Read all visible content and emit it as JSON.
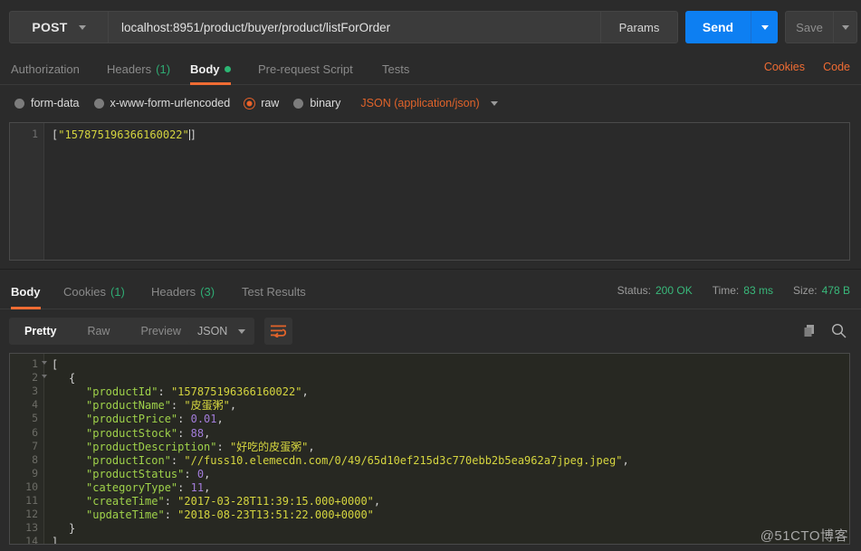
{
  "request": {
    "method": "POST",
    "url": "localhost:8951/product/buyer/product/listForOrder",
    "params_label": "Params",
    "send_label": "Send",
    "save_label": "Save",
    "tabs": [
      {
        "label": "Authorization",
        "active": false
      },
      {
        "label": "Headers",
        "count": "(1)",
        "active": false
      },
      {
        "label": "Body",
        "active": true,
        "dot": true
      },
      {
        "label": "Pre-request Script",
        "active": false
      },
      {
        "label": "Tests",
        "active": false
      }
    ],
    "cookies_link": "Cookies",
    "code_link": "Code",
    "body_types": [
      {
        "label": "form-data",
        "selected": false
      },
      {
        "label": "x-www-form-urlencoded",
        "selected": false
      },
      {
        "label": "raw",
        "selected": true
      },
      {
        "label": "binary",
        "selected": false
      }
    ],
    "content_type": "JSON (application/json)",
    "body_line_number": "1",
    "body_bracket_open": "[",
    "body_quote_open": "\"",
    "body_value": "157875196366160022",
    "body_quote_close": "\"",
    "body_bracket_close": "]"
  },
  "response": {
    "tabs": [
      {
        "label": "Body",
        "active": true
      },
      {
        "label": "Cookies",
        "count": "(1)",
        "active": false
      },
      {
        "label": "Headers",
        "count": "(3)",
        "active": false
      },
      {
        "label": "Test Results",
        "active": false
      }
    ],
    "status_label": "Status:",
    "status_value": "200 OK",
    "time_label": "Time:",
    "time_value": "83 ms",
    "size_label": "Size:",
    "size_value": "478 B",
    "view_modes": [
      {
        "label": "Pretty",
        "active": true
      },
      {
        "label": "Raw",
        "active": false
      },
      {
        "label": "Preview",
        "active": false
      }
    ],
    "format": "JSON",
    "lines": [
      {
        "n": "1",
        "fold": true,
        "indent": 0,
        "parts": [
          {
            "t": "[",
            "c": "pln"
          }
        ]
      },
      {
        "n": "2",
        "fold": true,
        "indent": 1,
        "parts": [
          {
            "t": "{",
            "c": "pln"
          }
        ]
      },
      {
        "n": "3",
        "fold": false,
        "indent": 2,
        "parts": [
          {
            "t": "\"productId\"",
            "c": "key"
          },
          {
            "t": ": ",
            "c": "pln"
          },
          {
            "t": "\"157875196366160022\"",
            "c": "str"
          },
          {
            "t": ",",
            "c": "pln"
          }
        ]
      },
      {
        "n": "4",
        "fold": false,
        "indent": 2,
        "parts": [
          {
            "t": "\"productName\"",
            "c": "key"
          },
          {
            "t": ": ",
            "c": "pln"
          },
          {
            "t": "\"皮蛋粥\"",
            "c": "str"
          },
          {
            "t": ",",
            "c": "pln"
          }
        ]
      },
      {
        "n": "5",
        "fold": false,
        "indent": 2,
        "parts": [
          {
            "t": "\"productPrice\"",
            "c": "key"
          },
          {
            "t": ": ",
            "c": "pln"
          },
          {
            "t": "0.01",
            "c": "num"
          },
          {
            "t": ",",
            "c": "pln"
          }
        ]
      },
      {
        "n": "6",
        "fold": false,
        "indent": 2,
        "parts": [
          {
            "t": "\"productStock\"",
            "c": "key"
          },
          {
            "t": ": ",
            "c": "pln"
          },
          {
            "t": "88",
            "c": "num"
          },
          {
            "t": ",",
            "c": "pln"
          }
        ]
      },
      {
        "n": "7",
        "fold": false,
        "indent": 2,
        "parts": [
          {
            "t": "\"productDescription\"",
            "c": "key"
          },
          {
            "t": ": ",
            "c": "pln"
          },
          {
            "t": "\"好吃的皮蛋粥\"",
            "c": "str"
          },
          {
            "t": ",",
            "c": "pln"
          }
        ]
      },
      {
        "n": "8",
        "fold": false,
        "indent": 2,
        "parts": [
          {
            "t": "\"productIcon\"",
            "c": "key"
          },
          {
            "t": ": ",
            "c": "pln"
          },
          {
            "t": "\"//fuss10.elemecdn.com/0/49/65d10ef215d3c770ebb2b5ea962a7jpeg.jpeg\"",
            "c": "str"
          },
          {
            "t": ",",
            "c": "pln"
          }
        ]
      },
      {
        "n": "9",
        "fold": false,
        "indent": 2,
        "parts": [
          {
            "t": "\"productStatus\"",
            "c": "key"
          },
          {
            "t": ": ",
            "c": "pln"
          },
          {
            "t": "0",
            "c": "num"
          },
          {
            "t": ",",
            "c": "pln"
          }
        ]
      },
      {
        "n": "10",
        "fold": false,
        "indent": 2,
        "parts": [
          {
            "t": "\"categoryType\"",
            "c": "key"
          },
          {
            "t": ": ",
            "c": "pln"
          },
          {
            "t": "11",
            "c": "num"
          },
          {
            "t": ",",
            "c": "pln"
          }
        ]
      },
      {
        "n": "11",
        "fold": false,
        "indent": 2,
        "parts": [
          {
            "t": "\"createTime\"",
            "c": "key"
          },
          {
            "t": ": ",
            "c": "pln"
          },
          {
            "t": "\"2017-03-28T11:39:15.000+0000\"",
            "c": "str"
          },
          {
            "t": ",",
            "c": "pln"
          }
        ]
      },
      {
        "n": "12",
        "fold": false,
        "indent": 2,
        "parts": [
          {
            "t": "\"updateTime\"",
            "c": "key"
          },
          {
            "t": ": ",
            "c": "pln"
          },
          {
            "t": "\"2018-08-23T13:51:22.000+0000\"",
            "c": "str"
          }
        ]
      },
      {
        "n": "13",
        "fold": false,
        "indent": 1,
        "parts": [
          {
            "t": "}",
            "c": "pln"
          }
        ]
      },
      {
        "n": "14",
        "fold": false,
        "indent": 0,
        "parts": [
          {
            "t": "]",
            "c": "pln"
          }
        ]
      }
    ]
  },
  "watermark": "@51CTO博客",
  "colors": {
    "accent_orange": "#f06c33",
    "send_blue": "#0d7ff2",
    "status_green": "#39b97b",
    "json_key": "#9fd24a",
    "json_string": "#d5d53f",
    "json_number": "#a37ddb"
  }
}
